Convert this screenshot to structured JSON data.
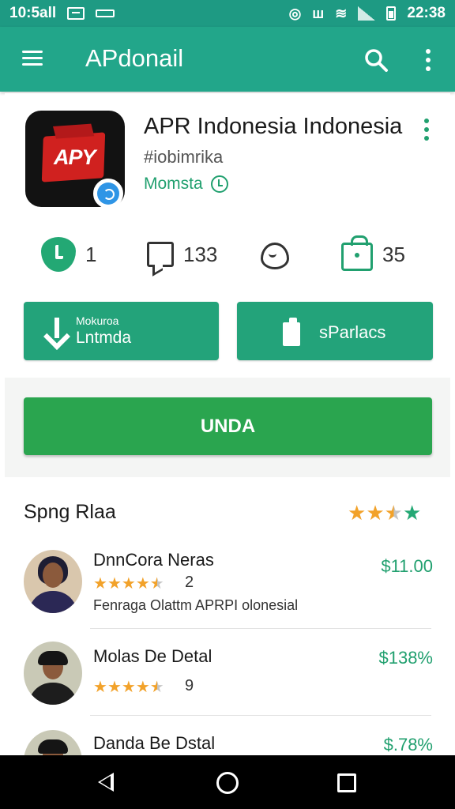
{
  "status_bar": {
    "time_left": "10:5all",
    "time_right": "22:38"
  },
  "app_bar": {
    "title": "APdonail",
    "icons": [
      "menu-icon",
      "search-icon",
      "more-vert-icon"
    ]
  },
  "app": {
    "name": "APR Indonesia Indonesia",
    "handle": "#iobimrika",
    "developer": "Momsta",
    "icon_text": "APY",
    "stats": [
      {
        "icon": "shield-check-icon",
        "value": "1"
      },
      {
        "icon": "chat-icon",
        "value": "133"
      },
      {
        "icon": "heart-icon",
        "value": ""
      },
      {
        "icon": "bag-icon",
        "value": "35"
      }
    ]
  },
  "actions": {
    "download_sub": "Mokuroa",
    "download_label": "Lntmda",
    "share_label": "sParlacs",
    "primary_label": "UNDA"
  },
  "reviews": {
    "title": "Spng Rlaa",
    "summary_rating": 3.5,
    "items": [
      {
        "name": "DnnCora Neras",
        "price": "$11.00",
        "rating": 4.5,
        "count": "2",
        "text": "Fenraga Olattm APRPI olonesial"
      },
      {
        "name": "Molas De Detal",
        "price": "$138%",
        "rating": 4.5,
        "count": "9",
        "text": ""
      },
      {
        "name": "Danda Be Dstal",
        "price": "$.78%",
        "rating": 0,
        "count": "",
        "text": ""
      }
    ]
  },
  "colors": {
    "primary": "#22a68a",
    "accent_green": "#23a37a",
    "primary_button": "#2aa54f",
    "star": "#f2a22a"
  }
}
